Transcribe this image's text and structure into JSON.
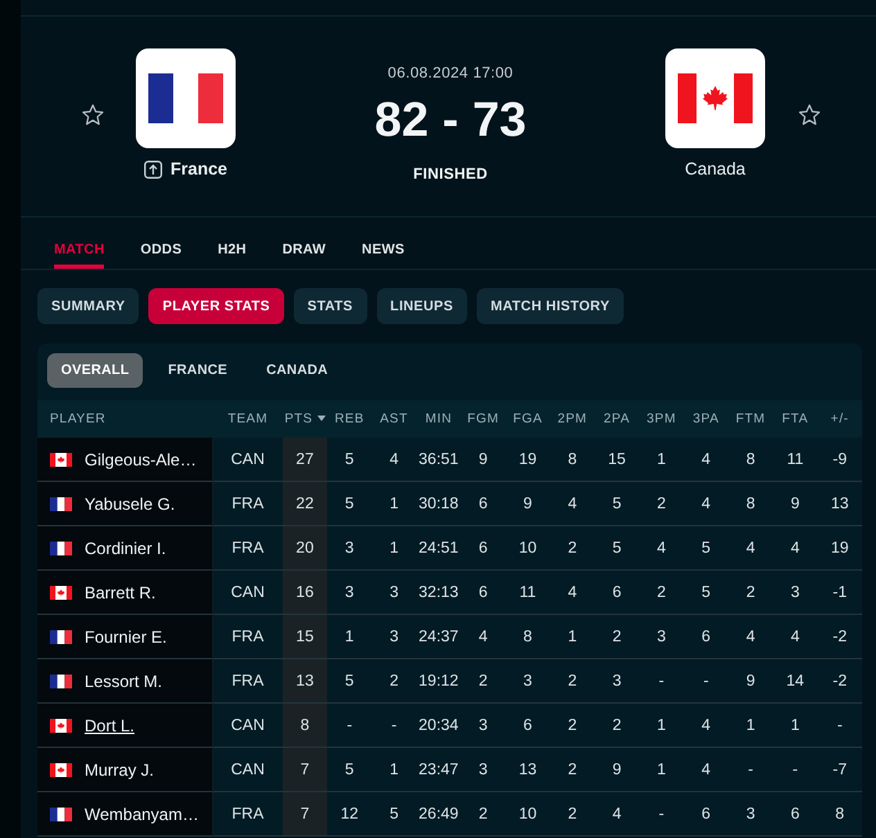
{
  "header": {
    "teams": [
      {
        "name": "France",
        "kind": "france",
        "winner": true,
        "badge": true,
        "favorite": false
      },
      {
        "name": "Canada",
        "kind": "canada",
        "winner": false,
        "badge": false,
        "favorite": false
      }
    ],
    "date": "06.08.2024 17:00",
    "score": {
      "home": "82",
      "separator": "-",
      "away": "73"
    },
    "status": "FINISHED"
  },
  "tabs": [
    {
      "label": "MATCH",
      "selected": true
    },
    {
      "label": "ODDS",
      "selected": false
    },
    {
      "label": "H2H",
      "selected": false
    },
    {
      "label": "DRAW",
      "selected": false
    },
    {
      "label": "NEWS",
      "selected": false
    }
  ],
  "sub_tabs": [
    {
      "label": "SUMMARY",
      "selected": false
    },
    {
      "label": "PLAYER STATS",
      "selected": true
    },
    {
      "label": "STATS",
      "selected": false
    },
    {
      "label": "LINEUPS",
      "selected": false
    },
    {
      "label": "MATCH HISTORY",
      "selected": false
    }
  ],
  "filters": [
    {
      "label": "OVERALL",
      "selected": true
    },
    {
      "label": "FRANCE",
      "selected": false
    },
    {
      "label": "CANADA",
      "selected": false
    }
  ],
  "table": {
    "columns": [
      {
        "label": "PLAYER",
        "sorted": false
      },
      {
        "label": "TEAM",
        "sorted": false
      },
      {
        "label": "PTS",
        "sorted": true
      },
      {
        "label": "REB",
        "sorted": false
      },
      {
        "label": "AST",
        "sorted": false
      },
      {
        "label": "MIN",
        "sorted": false
      },
      {
        "label": "FGM",
        "sorted": false
      },
      {
        "label": "FGA",
        "sorted": false
      },
      {
        "label": "2PM",
        "sorted": false
      },
      {
        "label": "2PA",
        "sorted": false
      },
      {
        "label": "3PM",
        "sorted": false
      },
      {
        "label": "3PA",
        "sorted": false
      },
      {
        "label": "FTM",
        "sorted": false
      },
      {
        "label": "FTA",
        "sorted": false
      },
      {
        "label": "+/-",
        "sorted": false
      }
    ],
    "rows": [
      {
        "kind": "canada",
        "hovered": false,
        "cells": [
          "Gilgeous-Ale…",
          "CAN",
          "27",
          "5",
          "4",
          "36:51",
          "9",
          "19",
          "8",
          "15",
          "1",
          "4",
          "8",
          "11",
          "-9"
        ]
      },
      {
        "kind": "france",
        "hovered": false,
        "cells": [
          "Yabusele G.",
          "FRA",
          "22",
          "5",
          "1",
          "30:18",
          "6",
          "9",
          "4",
          "5",
          "2",
          "4",
          "8",
          "9",
          "13"
        ]
      },
      {
        "kind": "france",
        "hovered": false,
        "cells": [
          "Cordinier I.",
          "FRA",
          "20",
          "3",
          "1",
          "24:51",
          "6",
          "10",
          "2",
          "5",
          "4",
          "5",
          "4",
          "4",
          "19"
        ]
      },
      {
        "kind": "canada",
        "hovered": false,
        "cells": [
          "Barrett R.",
          "CAN",
          "16",
          "3",
          "3",
          "32:13",
          "6",
          "11",
          "4",
          "6",
          "2",
          "5",
          "2",
          "3",
          "-1"
        ]
      },
      {
        "kind": "france",
        "hovered": false,
        "cells": [
          "Fournier E.",
          "FRA",
          "15",
          "1",
          "3",
          "24:37",
          "4",
          "8",
          "1",
          "2",
          "3",
          "6",
          "4",
          "4",
          "-2"
        ]
      },
      {
        "kind": "france",
        "hovered": false,
        "cells": [
          "Lessort M.",
          "FRA",
          "13",
          "5",
          "2",
          "19:12",
          "2",
          "3",
          "2",
          "3",
          "-",
          "-",
          "9",
          "14",
          "-2"
        ]
      },
      {
        "kind": "canada",
        "hovered": true,
        "cells": [
          "Dort L.",
          "CAN",
          "8",
          "-",
          "-",
          "20:34",
          "3",
          "6",
          "2",
          "2",
          "1",
          "4",
          "1",
          "1",
          "-"
        ]
      },
      {
        "kind": "canada",
        "hovered": false,
        "cells": [
          "Murray J.",
          "CAN",
          "7",
          "5",
          "1",
          "23:47",
          "3",
          "13",
          "2",
          "9",
          "1",
          "4",
          "-",
          "-",
          "-7"
        ]
      },
      {
        "kind": "france",
        "hovered": false,
        "cells": [
          "Wembanyam…",
          "FRA",
          "7",
          "12",
          "5",
          "26:49",
          "2",
          "10",
          "2",
          "4",
          "-",
          "6",
          "3",
          "6",
          "8"
        ]
      }
    ]
  }
}
